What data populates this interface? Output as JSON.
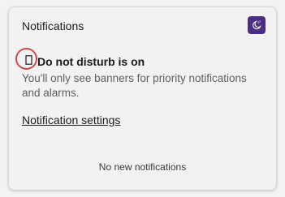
{
  "panel": {
    "title": "Notifications",
    "dnd_toggle_icon": "moon-zz-icon",
    "accent_color": "#4b2e83"
  },
  "dnd": {
    "status_icon": "notification-off-icon",
    "title": "Do not disturb is on",
    "description": "You'll only see banners for priority notifications and alarms.",
    "highlight_color": "#d04a4a"
  },
  "links": {
    "settings": "Notification settings"
  },
  "empty_state": {
    "text": "No new notifications"
  }
}
